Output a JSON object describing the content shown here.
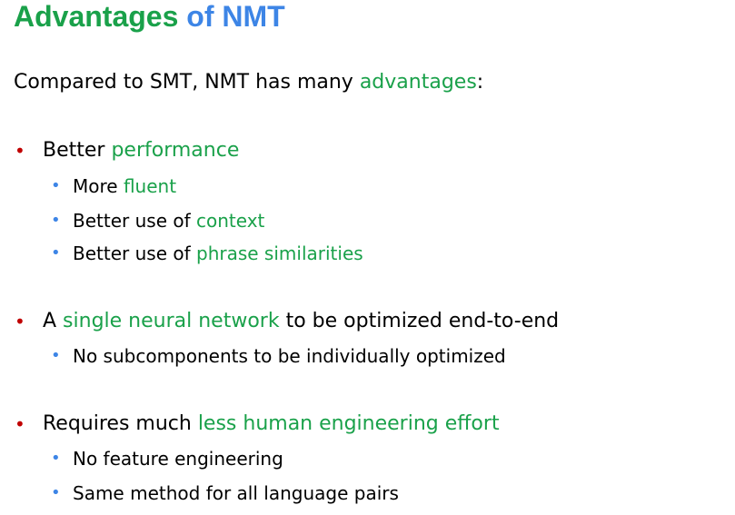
{
  "title": {
    "part1": "Advantages",
    "part2": " of NMT"
  },
  "intro": {
    "pre": "Compared to SMT, NMT has many ",
    "hl": "advantages",
    "post": ":"
  },
  "bullets": [
    {
      "pre": "Better ",
      "hl": "performance",
      "post": "",
      "sub": [
        {
          "pre": "More ",
          "hl": "fluent",
          "post": ""
        },
        {
          "pre": "Better use of ",
          "hl": "context",
          "post": ""
        },
        {
          "pre": "Better use of ",
          "hl": "phrase similarities",
          "post": ""
        }
      ]
    },
    {
      "pre": "A ",
      "hl": "single neural network",
      "post": " to be optimized end-to-end",
      "sub": [
        {
          "text": "No subcomponents to be individually optimized"
        }
      ]
    },
    {
      "pre": "Requires much ",
      "hl": "less human engineering effort",
      "post": "",
      "sub": [
        {
          "text": "No feature engineering"
        },
        {
          "text": "Same method for all language pairs"
        }
      ]
    }
  ],
  "colors": {
    "green": "#1aa14a",
    "blue": "#3d85e6",
    "red_bullet": "#c00000"
  },
  "bullet_glyph": "•"
}
